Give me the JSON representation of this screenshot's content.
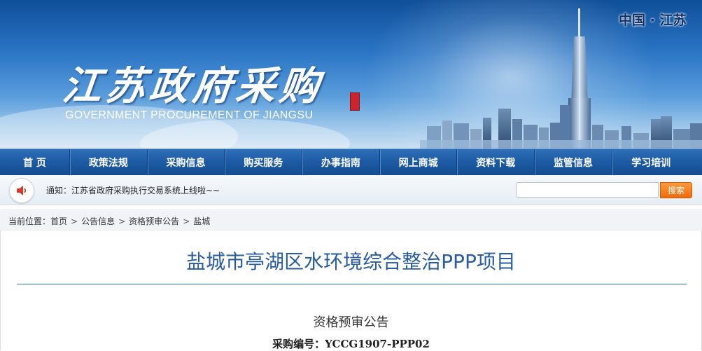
{
  "banner": {
    "calligraphy_title": "江苏政府采购",
    "subtitle": "GOVERNMENT PROCUREMENT OF JIANGSU",
    "region": "中国 · 江苏"
  },
  "nav": {
    "items": [
      {
        "label": "首 页"
      },
      {
        "label": "政策法规"
      },
      {
        "label": "采购信息"
      },
      {
        "label": "购买服务"
      },
      {
        "label": "办事指南"
      },
      {
        "label": "网上商城"
      },
      {
        "label": "资料下载"
      },
      {
        "label": "监管信息"
      },
      {
        "label": "学习培训"
      }
    ]
  },
  "notice_bar": {
    "icon": "speaker-icon",
    "text": "通知：江苏省政府采购执行交易系统上线啦~~",
    "search_value": "",
    "search_button": "搜索"
  },
  "breadcrumb": {
    "label": "当前位置：",
    "items": [
      "首页",
      "公告信息",
      "资格预审公告",
      "盐城"
    ],
    "separator": ">"
  },
  "article": {
    "title": "盐城市亭湖区水环境综合整治PPP项目",
    "notice_type": "资格预审公告",
    "procurement_no_label": "采购编号：",
    "procurement_no": "YCCG1907-PPP02"
  },
  "colors": {
    "nav_bg": "#1c5aa3",
    "title_color": "#2a5d9f",
    "search_button": "#ee6a0b"
  }
}
